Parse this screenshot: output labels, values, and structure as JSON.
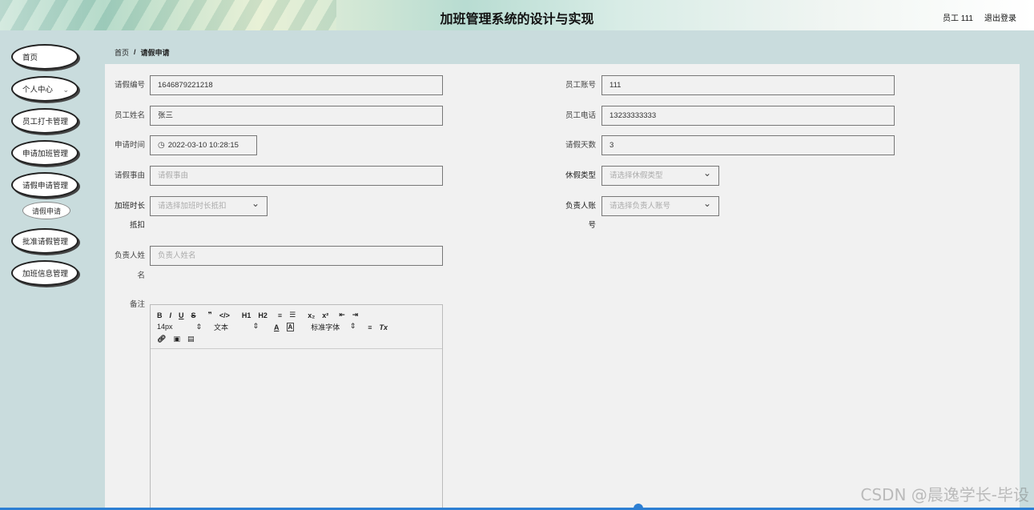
{
  "header": {
    "title": "加班管理系统的设计与实现",
    "user": "员工 111",
    "logout": "退出登录"
  },
  "sidebar": {
    "items": [
      {
        "label": "首页"
      },
      {
        "label": "个人中心"
      },
      {
        "label": "员工打卡管理"
      },
      {
        "label": "申请加班管理"
      },
      {
        "label": "请假申请管理"
      },
      {
        "label": "请假申请"
      },
      {
        "label": "批准请假管理"
      },
      {
        "label": "加班信息管理"
      }
    ]
  },
  "breadcrumb": {
    "home": "首页",
    "separator": "/",
    "current": "请假申请"
  },
  "form": {
    "leave_no": {
      "label": "请假编号",
      "value": "1646879221218"
    },
    "emp_account": {
      "label": "员工账号",
      "value": "111"
    },
    "emp_name": {
      "label": "员工姓名",
      "value": "张三"
    },
    "emp_phone": {
      "label": "员工电话",
      "value": "13233333333"
    },
    "apply_time": {
      "label": "申请时间",
      "value": "2022-03-10 10:28:15"
    },
    "leave_days": {
      "label": "请假天数",
      "value": "3"
    },
    "leave_reason": {
      "label": "请假事由",
      "placeholder": "请假事由"
    },
    "leave_type": {
      "label": "休假类型",
      "placeholder": "请选择休假类型"
    },
    "overtime_offset": {
      "label_1": "加班时长",
      "label_2": "抵扣",
      "placeholder": "请选择加班时长抵扣"
    },
    "manager_account": {
      "label_1": "负责人账",
      "label_2": "号",
      "placeholder": "请选择负责人账号"
    },
    "manager_name": {
      "label_1": "负责人姓",
      "label_2": "名",
      "placeholder": "负责人姓名"
    },
    "remark": {
      "label": "备注"
    }
  },
  "editor": {
    "row1": [
      "B",
      "I",
      "U",
      "S",
      "❞",
      "</>",
      "H1",
      "H2",
      "≡",
      "☰",
      "x₂",
      "x²",
      "⇤",
      "⇥"
    ],
    "font_size": "14px",
    "text_style": "文本",
    "font_family": "标准字体",
    "color_a": "A",
    "bg_a": "A",
    "align": "≡",
    "clear": "Tx"
  },
  "watermark": "CSDN @晨逸学长-毕设"
}
